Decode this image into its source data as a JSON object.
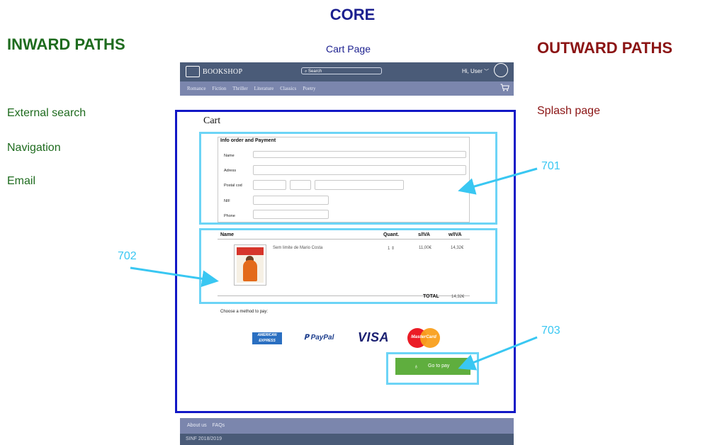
{
  "headings": {
    "core": "CORE",
    "core_sub": "Cart Page",
    "inward": "INWARD PATHS",
    "outward": "OUTWARD PATHS"
  },
  "inward_paths": [
    "External search",
    "Navigation",
    "Email"
  ],
  "outward_paths": [
    "Splash page"
  ],
  "site": {
    "logo": "BOOKSHOP",
    "search_placeholder": "Search",
    "greeting": "Hi, User",
    "nav": [
      "Romance",
      "Fiction",
      "Thriller",
      "Literature",
      "Classics",
      "Poetry"
    ]
  },
  "cart": {
    "title": "Cart",
    "form_title": "Info order and Payment",
    "labels": [
      "Name",
      "Adress",
      "Postal cod",
      "NIF",
      "Phone"
    ],
    "table_headers": [
      "Name",
      "Quant.",
      "s/IVA",
      "w/IVA"
    ],
    "item": {
      "title": "Sem limite de Mario Costa",
      "quantity": "1",
      "price_no_vat": "11,00€",
      "price_vat": "14,32€"
    },
    "total_label": "TOTAL",
    "total_value": "14,32€",
    "choose_method": "Choose a method to pay:",
    "payment_methods": {
      "amex": "AMERICAN EXPRESS",
      "paypal": "PayPal",
      "visa": "VISA",
      "mastercard": "MasterCard"
    },
    "pay_button": "Go to pay"
  },
  "footer": {
    "links": [
      "About us",
      "FAQs"
    ],
    "copyright": "SINF 2018/2019"
  },
  "callouts": {
    "c701": "701",
    "c702": "702",
    "c703": "703"
  },
  "colors": {
    "core_blue": "#1b1f8f",
    "inward_green": "#1e6b1e",
    "outward_red": "#8b1414",
    "cart_frame": "#1218c6",
    "callout_cyan": "#39c7f2",
    "header_dark": "#4a5b78",
    "header_light": "#7b86ad",
    "pay_green": "#5fae3e"
  }
}
